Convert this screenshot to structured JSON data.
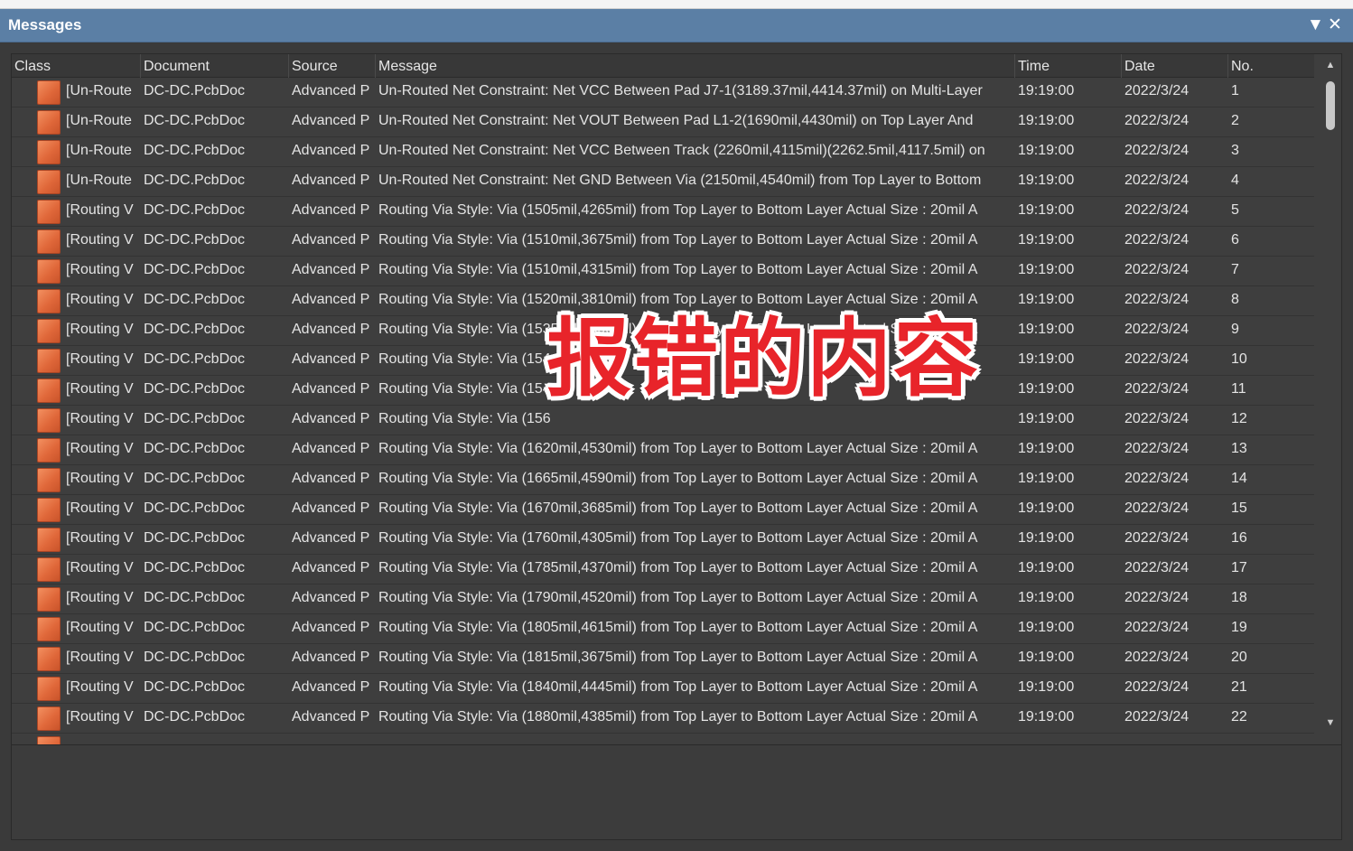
{
  "panel": {
    "title": "Messages",
    "dropdown_icon": "triangle-down-icon",
    "close_icon": "close-x-icon"
  },
  "columns": [
    "Class",
    "Document",
    "Source",
    "Message",
    "Time",
    "Date",
    "No."
  ],
  "rows": [
    {
      "class": "[Un-Route",
      "document": "DC-DC.PcbDoc",
      "source": "Advanced P",
      "message": "Un-Routed Net Constraint: Net VCC Between Pad J7-1(3189.37mil,4414.37mil) on Multi-Layer",
      "time": "19:19:00",
      "date": "2022/3/24",
      "no": "1"
    },
    {
      "class": "[Un-Route",
      "document": "DC-DC.PcbDoc",
      "source": "Advanced P",
      "message": "Un-Routed Net Constraint: Net VOUT Between Pad L1-2(1690mil,4430mil) on Top Layer And",
      "time": "19:19:00",
      "date": "2022/3/24",
      "no": "2"
    },
    {
      "class": "[Un-Route",
      "document": "DC-DC.PcbDoc",
      "source": "Advanced P",
      "message": "Un-Routed Net Constraint: Net VCC Between Track (2260mil,4115mil)(2262.5mil,4117.5mil) on",
      "time": "19:19:00",
      "date": "2022/3/24",
      "no": "3"
    },
    {
      "class": "[Un-Route",
      "document": "DC-DC.PcbDoc",
      "source": "Advanced P",
      "message": "Un-Routed Net Constraint: Net GND Between Via (2150mil,4540mil) from Top Layer to Bottom",
      "time": "19:19:00",
      "date": "2022/3/24",
      "no": "4"
    },
    {
      "class": "[Routing V",
      "document": "DC-DC.PcbDoc",
      "source": "Advanced P",
      "message": "Routing Via Style: Via (1505mil,4265mil) from Top Layer to Bottom Layer Actual Size : 20mil A",
      "time": "19:19:00",
      "date": "2022/3/24",
      "no": "5"
    },
    {
      "class": "[Routing V",
      "document": "DC-DC.PcbDoc",
      "source": "Advanced P",
      "message": "Routing Via Style: Via (1510mil,3675mil) from Top Layer to Bottom Layer Actual Size : 20mil A",
      "time": "19:19:00",
      "date": "2022/3/24",
      "no": "6"
    },
    {
      "class": "[Routing V",
      "document": "DC-DC.PcbDoc",
      "source": "Advanced P",
      "message": "Routing Via Style: Via (1510mil,4315mil) from Top Layer to Bottom Layer Actual Size : 20mil A",
      "time": "19:19:00",
      "date": "2022/3/24",
      "no": "7"
    },
    {
      "class": "[Routing V",
      "document": "DC-DC.PcbDoc",
      "source": "Advanced P",
      "message": "Routing Via Style: Via (1520mil,3810mil) from Top Layer to Bottom Layer Actual Size : 20mil A",
      "time": "19:19:00",
      "date": "2022/3/24",
      "no": "8"
    },
    {
      "class": "[Routing V",
      "document": "DC-DC.PcbDoc",
      "source": "Advanced P",
      "message": "Routing Via Style: Via (1535mil,4500mil) from Top Layer to Bottom Layer Actual Size : 20mil A",
      "time": "19:19:00",
      "date": "2022/3/24",
      "no": "9"
    },
    {
      "class": "[Routing V",
      "document": "DC-DC.PcbDoc",
      "source": "Advanced P",
      "message": "Routing Via Style: Via (154",
      "time": "19:19:00",
      "date": "2022/3/24",
      "no": "10"
    },
    {
      "class": "[Routing V",
      "document": "DC-DC.PcbDoc",
      "source": "Advanced P",
      "message": "Routing Via Style: Via (154",
      "time": "19:19:00",
      "date": "2022/3/24",
      "no": "11"
    },
    {
      "class": "[Routing V",
      "document": "DC-DC.PcbDoc",
      "source": "Advanced P",
      "message": "Routing Via Style: Via (156",
      "time": "19:19:00",
      "date": "2022/3/24",
      "no": "12"
    },
    {
      "class": "[Routing V",
      "document": "DC-DC.PcbDoc",
      "source": "Advanced P",
      "message": "Routing Via Style: Via (1620mil,4530mil) from Top Layer to Bottom Layer Actual Size : 20mil A",
      "time": "19:19:00",
      "date": "2022/3/24",
      "no": "13"
    },
    {
      "class": "[Routing V",
      "document": "DC-DC.PcbDoc",
      "source": "Advanced P",
      "message": "Routing Via Style: Via (1665mil,4590mil) from Top Layer to Bottom Layer Actual Size : 20mil A",
      "time": "19:19:00",
      "date": "2022/3/24",
      "no": "14"
    },
    {
      "class": "[Routing V",
      "document": "DC-DC.PcbDoc",
      "source": "Advanced P",
      "message": "Routing Via Style: Via (1670mil,3685mil) from Top Layer to Bottom Layer Actual Size : 20mil A",
      "time": "19:19:00",
      "date": "2022/3/24",
      "no": "15"
    },
    {
      "class": "[Routing V",
      "document": "DC-DC.PcbDoc",
      "source": "Advanced P",
      "message": "Routing Via Style: Via (1760mil,4305mil) from Top Layer to Bottom Layer Actual Size : 20mil A",
      "time": "19:19:00",
      "date": "2022/3/24",
      "no": "16"
    },
    {
      "class": "[Routing V",
      "document": "DC-DC.PcbDoc",
      "source": "Advanced P",
      "message": "Routing Via Style: Via (1785mil,4370mil) from Top Layer to Bottom Layer Actual Size : 20mil A",
      "time": "19:19:00",
      "date": "2022/3/24",
      "no": "17"
    },
    {
      "class": "[Routing V",
      "document": "DC-DC.PcbDoc",
      "source": "Advanced P",
      "message": "Routing Via Style: Via (1790mil,4520mil) from Top Layer to Bottom Layer Actual Size : 20mil A",
      "time": "19:19:00",
      "date": "2022/3/24",
      "no": "18"
    },
    {
      "class": "[Routing V",
      "document": "DC-DC.PcbDoc",
      "source": "Advanced P",
      "message": "Routing Via Style: Via (1805mil,4615mil) from Top Layer to Bottom Layer Actual Size : 20mil A",
      "time": "19:19:00",
      "date": "2022/3/24",
      "no": "19"
    },
    {
      "class": "[Routing V",
      "document": "DC-DC.PcbDoc",
      "source": "Advanced P",
      "message": "Routing Via Style: Via (1815mil,3675mil) from Top Layer to Bottom Layer Actual Size : 20mil A",
      "time": "19:19:00",
      "date": "2022/3/24",
      "no": "20"
    },
    {
      "class": "[Routing V",
      "document": "DC-DC.PcbDoc",
      "source": "Advanced P",
      "message": "Routing Via Style: Via (1840mil,4445mil) from Top Layer to Bottom Layer Actual Size : 20mil A",
      "time": "19:19:00",
      "date": "2022/3/24",
      "no": "21"
    },
    {
      "class": "[Routing V",
      "document": "DC-DC.PcbDoc",
      "source": "Advanced P",
      "message": "Routing Via Style: Via (1880mil,4385mil) from Top Layer to Bottom Layer Actual Size : 20mil A",
      "time": "19:19:00",
      "date": "2022/3/24",
      "no": "22"
    }
  ],
  "row_icon": "warning-square-icon",
  "overlay_text": "报错的内容",
  "colors": {
    "title_bar": "#5b7fa5",
    "background": "#3a3a3a",
    "text": "#e4e4e4",
    "row_icon": "#e0683a",
    "overlay": "#e8242a"
  }
}
